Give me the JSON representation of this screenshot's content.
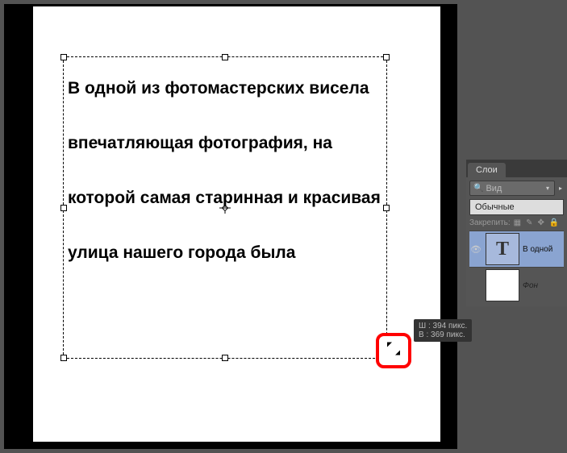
{
  "text_box": {
    "content": "В одной из фотомастерских висела впечатляющая фотография, на которой самая старинная и красивая улица нашего города была"
  },
  "tooltip": {
    "width_label": "Ш :",
    "width_value": "394 пикс.",
    "height_label": "В :",
    "height_value": "369 пикс."
  },
  "layers_panel": {
    "tab_label": "Слои",
    "filter_label": "Вид",
    "blend_mode": "Обычные",
    "lock_label": "Закрепить:",
    "layers": [
      {
        "name": "В одной",
        "thumb_letter": "T",
        "selected": true
      },
      {
        "name": "Фон",
        "thumb_letter": "",
        "selected": false
      }
    ]
  }
}
